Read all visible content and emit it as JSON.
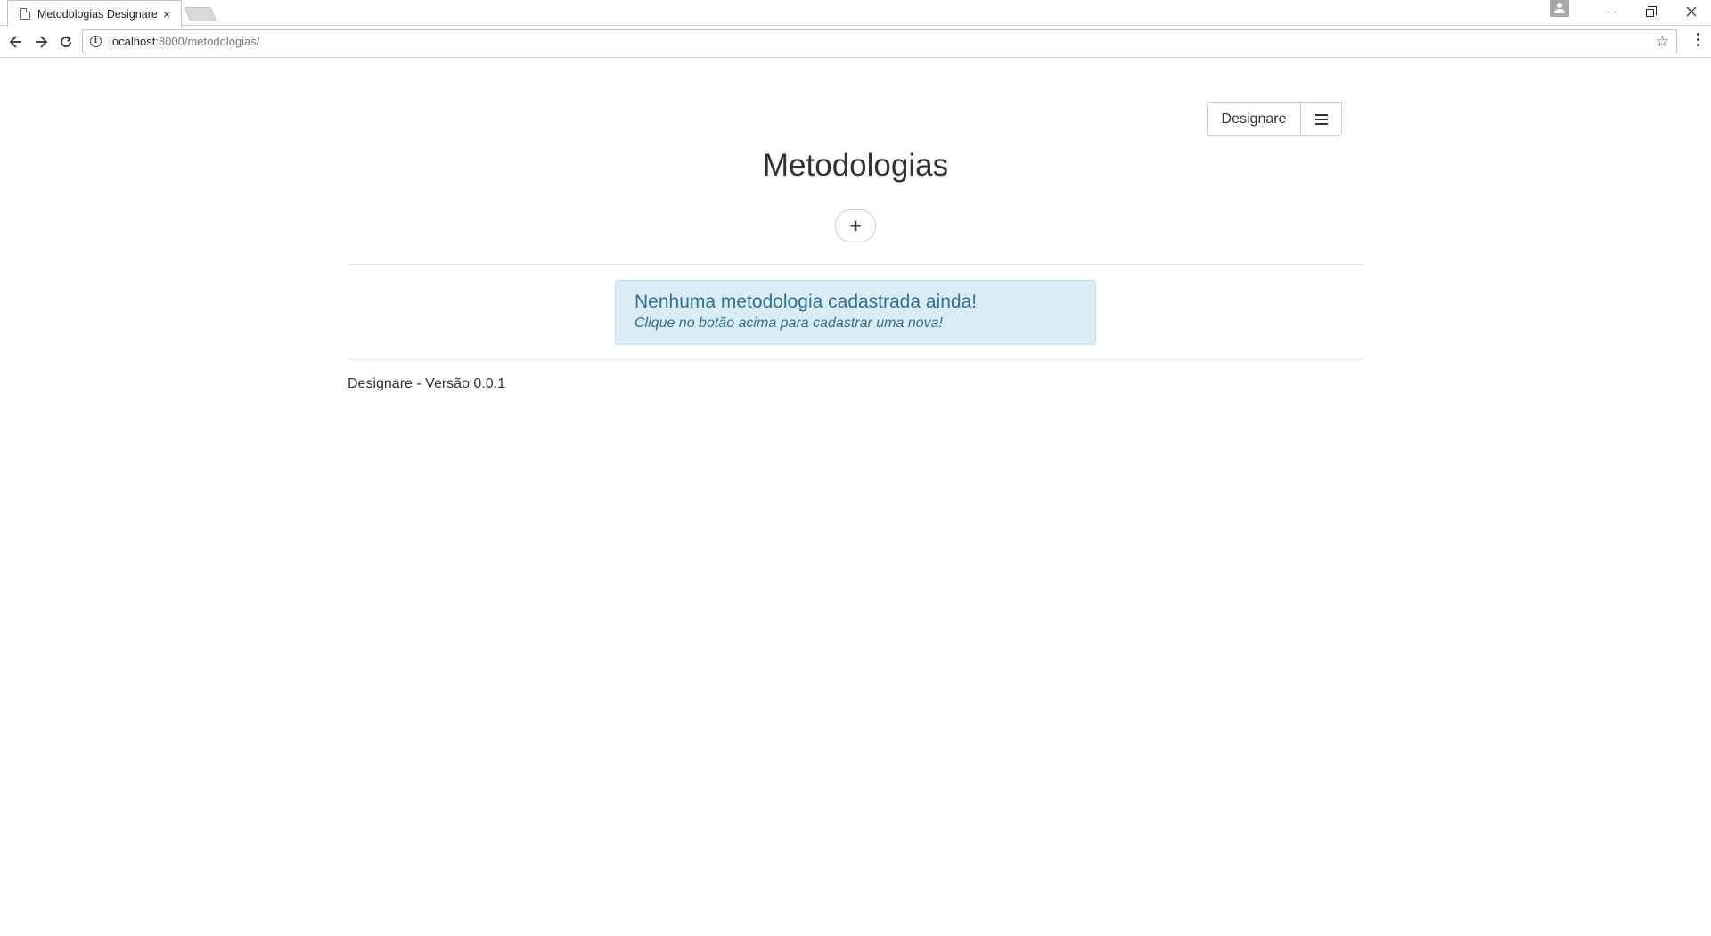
{
  "browser": {
    "tab_title": "Metodologias Designare",
    "tab_close": "×",
    "url_host": "localhost",
    "url_rest": ":8000/metodologias/"
  },
  "header": {
    "brand_label": "Designare"
  },
  "main": {
    "title": "Metodologias",
    "add_label": "+"
  },
  "alert": {
    "title": "Nenhuma metodologia cadastrada ainda!",
    "subtitle": "Clique no botão acima para cadastrar uma nova!"
  },
  "footer": {
    "text": "Designare - Versão 0.0.1"
  },
  "colors": {
    "alert_bg": "#d9edf7",
    "alert_text": "#31708f",
    "alert_border": "#bce8f1"
  }
}
